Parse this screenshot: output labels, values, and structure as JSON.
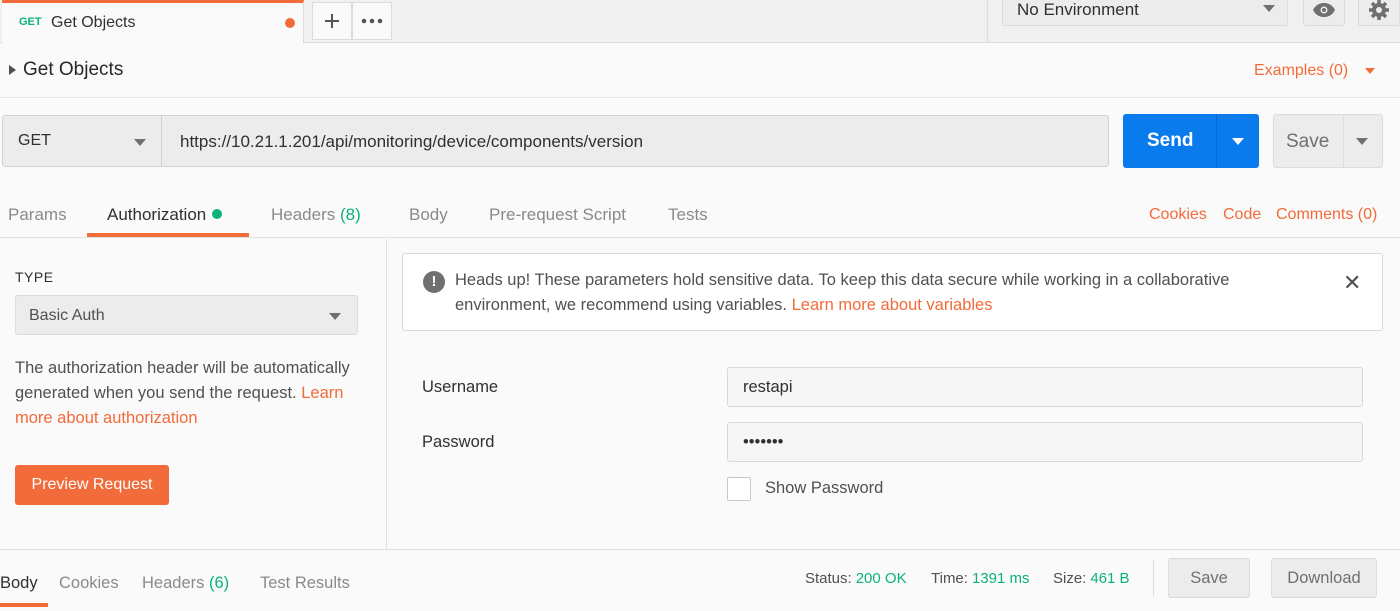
{
  "tabbar": {
    "active_tab": {
      "method": "GET",
      "name": "Get Objects"
    },
    "new_tab_icon": "plus-icon",
    "more_icon": "more-horizontal-icon",
    "environment": "No Environment",
    "eye_icon": "eye-icon",
    "settings_icon": "gear-icon"
  },
  "request": {
    "title": "Get Objects",
    "examples_label": "Examples (0)",
    "method": "GET",
    "url": "https://10.21.1.201/api/monitoring/device/components/version",
    "send_label": "Send",
    "save_label": "Save"
  },
  "request_tabs": {
    "params": "Params",
    "authorization": "Authorization",
    "headers": "Headers",
    "headers_count": "(8)",
    "body": "Body",
    "pre_request": "Pre-request Script",
    "tests": "Tests",
    "cookies": "Cookies",
    "code": "Code",
    "comments": "Comments (0)"
  },
  "auth": {
    "type_label": "TYPE",
    "type_value": "Basic Auth",
    "description": "The authorization header will be automatically generated when you send the request.",
    "description_link": "Learn more about authorization",
    "preview_button": "Preview Request",
    "banner_text": "Heads up! These parameters hold sensitive data. To keep this data secure while working in a collaborative environment, we recommend using variables.",
    "banner_link": "Learn more about variables",
    "banner_icon": "info-icon",
    "close_icon": "close-icon",
    "username_label": "Username",
    "username_value": "restapi",
    "password_label": "Password",
    "password_value": "•••••••",
    "show_password_label": "Show Password"
  },
  "response": {
    "tabs": {
      "body": "Body",
      "cookies": "Cookies",
      "headers": "Headers",
      "headers_count": "(6)",
      "test_results": "Test Results"
    },
    "status_label": "Status:",
    "status_value": "200 OK",
    "time_label": "Time:",
    "time_value": "1391 ms",
    "size_label": "Size:",
    "size_value": "461 B",
    "save_label": "Save",
    "download_label": "Download"
  },
  "colors": {
    "accent": "#f26b3a",
    "send": "#097bed",
    "success": "#0cb27b"
  }
}
